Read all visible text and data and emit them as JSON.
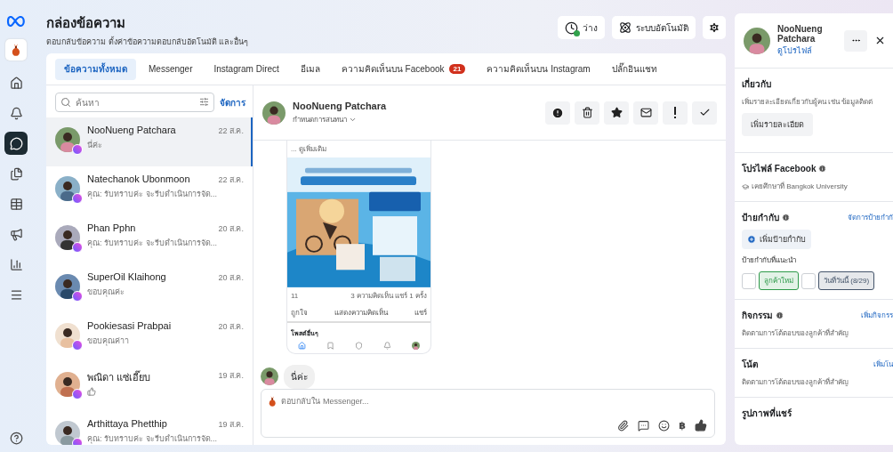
{
  "header": {
    "title": "กล่องข้อความ",
    "subtitle": "ตอบกลับข้อความ ตั้งค่าข้อความตอบกลับอัตโนมัติ และอื่นๆ",
    "status_button": {
      "label": "ว่าง",
      "online": true
    },
    "automation_button": {
      "label": "ระบบอัตโนมัติ"
    }
  },
  "rail": [
    {
      "kind": "home",
      "selected": false
    },
    {
      "kind": "bell",
      "selected": false
    },
    {
      "kind": "inbox",
      "selected": true
    },
    {
      "kind": "pages",
      "selected": false
    },
    {
      "kind": "table",
      "selected": false
    },
    {
      "kind": "ads",
      "selected": false
    },
    {
      "kind": "chart",
      "selected": false
    },
    {
      "kind": "menu",
      "selected": false
    }
  ],
  "tabs": [
    {
      "label": "ข้อความทั้งหมด",
      "selected": true
    },
    {
      "label": "Messenger",
      "selected": false
    },
    {
      "label": "Instagram Direct",
      "selected": false
    },
    {
      "label": "อีเมล",
      "selected": false
    },
    {
      "label": "ความคิดเห็นบน Facebook",
      "selected": false,
      "badge": "21"
    },
    {
      "label": "ความคิดเห็นบน Instagram",
      "selected": false
    },
    {
      "label": "ปลั๊กอินแชท",
      "selected": false
    }
  ],
  "search": {
    "placeholder": "ค้นหา",
    "manage": "จัดการ"
  },
  "conversations": [
    {
      "name": "NooNueng Patchara",
      "preview": "นี่ค่ะ",
      "date": "22 ส.ค.",
      "selected": true
    },
    {
      "name": "Natechanok Ubonmoon",
      "preview": "คุณ: รับทราบค่ะ จะรีบดำเนินการจัด...",
      "date": "22 ส.ค.",
      "selected": false
    },
    {
      "name": "Phan Pphn",
      "preview": "คุณ: รับทราบค่ะ จะรีบดำเนินการจัด...",
      "date": "20 ส.ค.",
      "selected": false
    },
    {
      "name": "SuperOil Klaihong",
      "preview": "ขอบคุณค่ะ",
      "date": "20 ส.ค.",
      "selected": false
    },
    {
      "name": "Pookiesasi Prabpai",
      "preview": "ขอบคุณค่าา",
      "date": "20 ส.ค.",
      "selected": false
    },
    {
      "name": "พณิดา แซ่เอี๊ยบ",
      "kind": "like",
      "date": "19 ส.ค.",
      "selected": false
    },
    {
      "name": "Arthittaya Phetthip",
      "preview": "คุณ: รับทราบค่ะ จะรีบดำเนินการจัด...",
      "date": "19 ส.ค.",
      "selected": false
    }
  ],
  "chat": {
    "name": "NooNueng Patchara",
    "subtitle": "กำหนดการสนทนา",
    "post": {
      "see_more": "... ดูเพิ่มเติม",
      "reactions": "11",
      "stats": "3 ความคิดเห็น แชร์ 1 ครั้ง",
      "actions": [
        "ถูกใจ",
        "แสดงความคิดเห็น",
        "แชร์"
      ],
      "more_posts": "โพสต์อื่นๆ"
    },
    "message": "นี่ค่ะ",
    "composer": {
      "placeholder": "ตอบกลับใน Messenger...",
      "currency": "฿"
    }
  },
  "profile": {
    "name": "NooNueng Patchara",
    "link": "ดูโปรไฟล์",
    "about": {
      "title": "เกี่ยวกับ",
      "text": "เพิ่มรายละเอียดเกี่ยวกับผู้คน เช่น ข้อมูลติดต่",
      "button": "เพิ่มรายละเอียด"
    },
    "facebook": {
      "title": "โปรไฟล์ Facebook",
      "education": "เคยศึกษาที่ Bangkok University"
    },
    "labels": {
      "title": "ป้ายกำกับ",
      "action": "จัดการป้ายกำกั",
      "add": "เพิ่มป้ายกำกับ",
      "suggested": "ป้ายกำกับที่แนะนำ",
      "tags": [
        {
          "label": "ลูกค้าใหม่",
          "color": "#2e9a4a",
          "checked": false
        },
        {
          "label": "วันที่วันนี้ (8/29)",
          "color": "#44546a",
          "checked": false
        }
      ]
    },
    "activity": {
      "title": "กิจกรรม",
      "action": "เพิ่มกิจกรร",
      "text": "ติดตามการโต้ตอบของลูกค้าที่สำคัญ"
    },
    "notes": {
      "title": "โน้ต",
      "action": "เพิ่มโน",
      "text": "ติดตามการโต้ตอบของลูกค้าที่สำคัญ"
    },
    "shared": {
      "title": "รูปภาพที่แชร์"
    }
  }
}
